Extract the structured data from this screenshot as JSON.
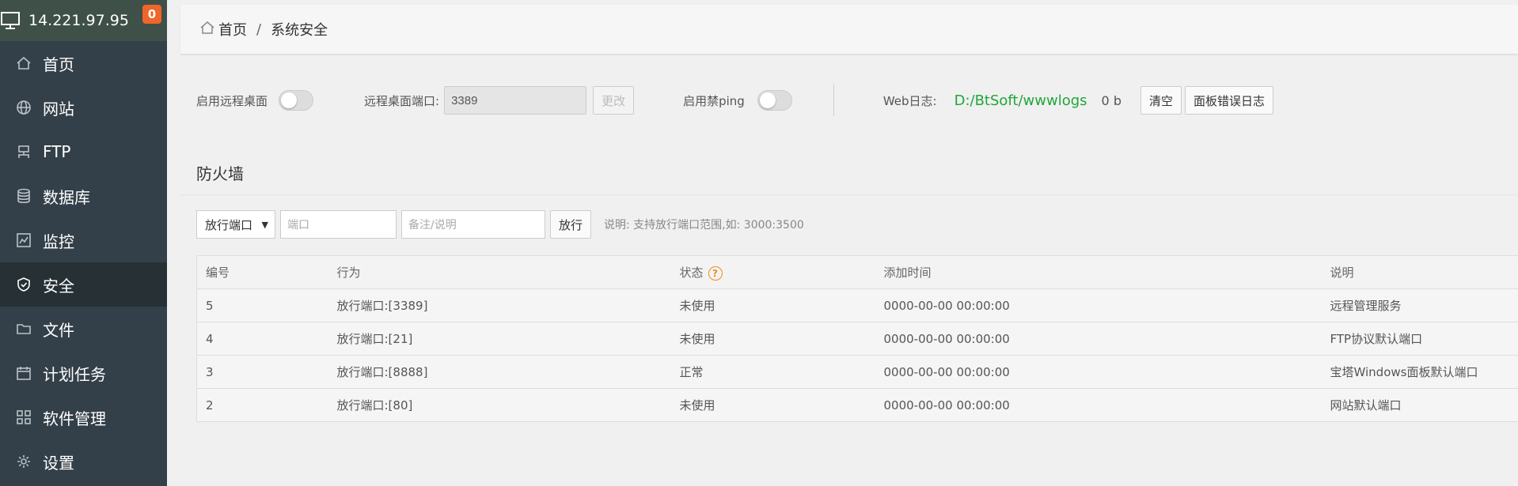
{
  "header": {
    "ip": "14.221.97.95",
    "badge": "0"
  },
  "sidebar": {
    "items": [
      {
        "label": "首页",
        "icon": "home-icon"
      },
      {
        "label": "网站",
        "icon": "globe-icon"
      },
      {
        "label": "FTP",
        "icon": "ftp-icon"
      },
      {
        "label": "数据库",
        "icon": "database-icon"
      },
      {
        "label": "监控",
        "icon": "monitor-chart-icon"
      },
      {
        "label": "安全",
        "icon": "shield-icon",
        "active": true
      },
      {
        "label": "文件",
        "icon": "folder-icon"
      },
      {
        "label": "计划任务",
        "icon": "calendar-icon"
      },
      {
        "label": "软件管理",
        "icon": "apps-icon"
      },
      {
        "label": "设置",
        "icon": "gear-icon"
      }
    ]
  },
  "breadcrumb": {
    "home": "首页",
    "separator": "/",
    "current": "系统安全"
  },
  "settings": {
    "remote_desktop_label": "启用远程桌面",
    "remote_port_label": "远程桌面端口:",
    "remote_port_value": "3389",
    "change_button": "更改",
    "ping_label": "启用禁ping",
    "weblog_label": "Web日志:",
    "weblog_path": "D:/BtSoft/wwwlogs",
    "weblog_size": "0 b",
    "clear_button": "清空",
    "panel_error_log_button": "面板错误日志"
  },
  "firewall": {
    "title": "防火墙",
    "select_value": "放行端口",
    "port_placeholder": "端口",
    "note_placeholder": "备注/说明",
    "allow_button": "放行",
    "hint": "说明: 支持放行端口范围,如: 3000:3500",
    "columns": [
      "编号",
      "行为",
      "状态",
      "添加时间",
      "说明"
    ],
    "status_help": "?",
    "rows": [
      {
        "id": "5",
        "action": "放行端口:[3389]",
        "status": "未使用",
        "time": "0000-00-00 00:00:00",
        "note": "远程管理服务"
      },
      {
        "id": "4",
        "action": "放行端口:[21]",
        "status": "未使用",
        "time": "0000-00-00 00:00:00",
        "note": "FTP协议默认端口"
      },
      {
        "id": "3",
        "action": "放行端口:[8888]",
        "status": "正常",
        "time": "0000-00-00 00:00:00",
        "note": "宝塔Windows面板默认端口"
      },
      {
        "id": "2",
        "action": "放行端口:[80]",
        "status": "未使用",
        "time": "0000-00-00 00:00:00",
        "note": "网站默认端口"
      }
    ]
  },
  "colors": {
    "accent_green": "#20a53a",
    "badge_orange": "#f0652a",
    "sidebar_bg": "#344049"
  }
}
